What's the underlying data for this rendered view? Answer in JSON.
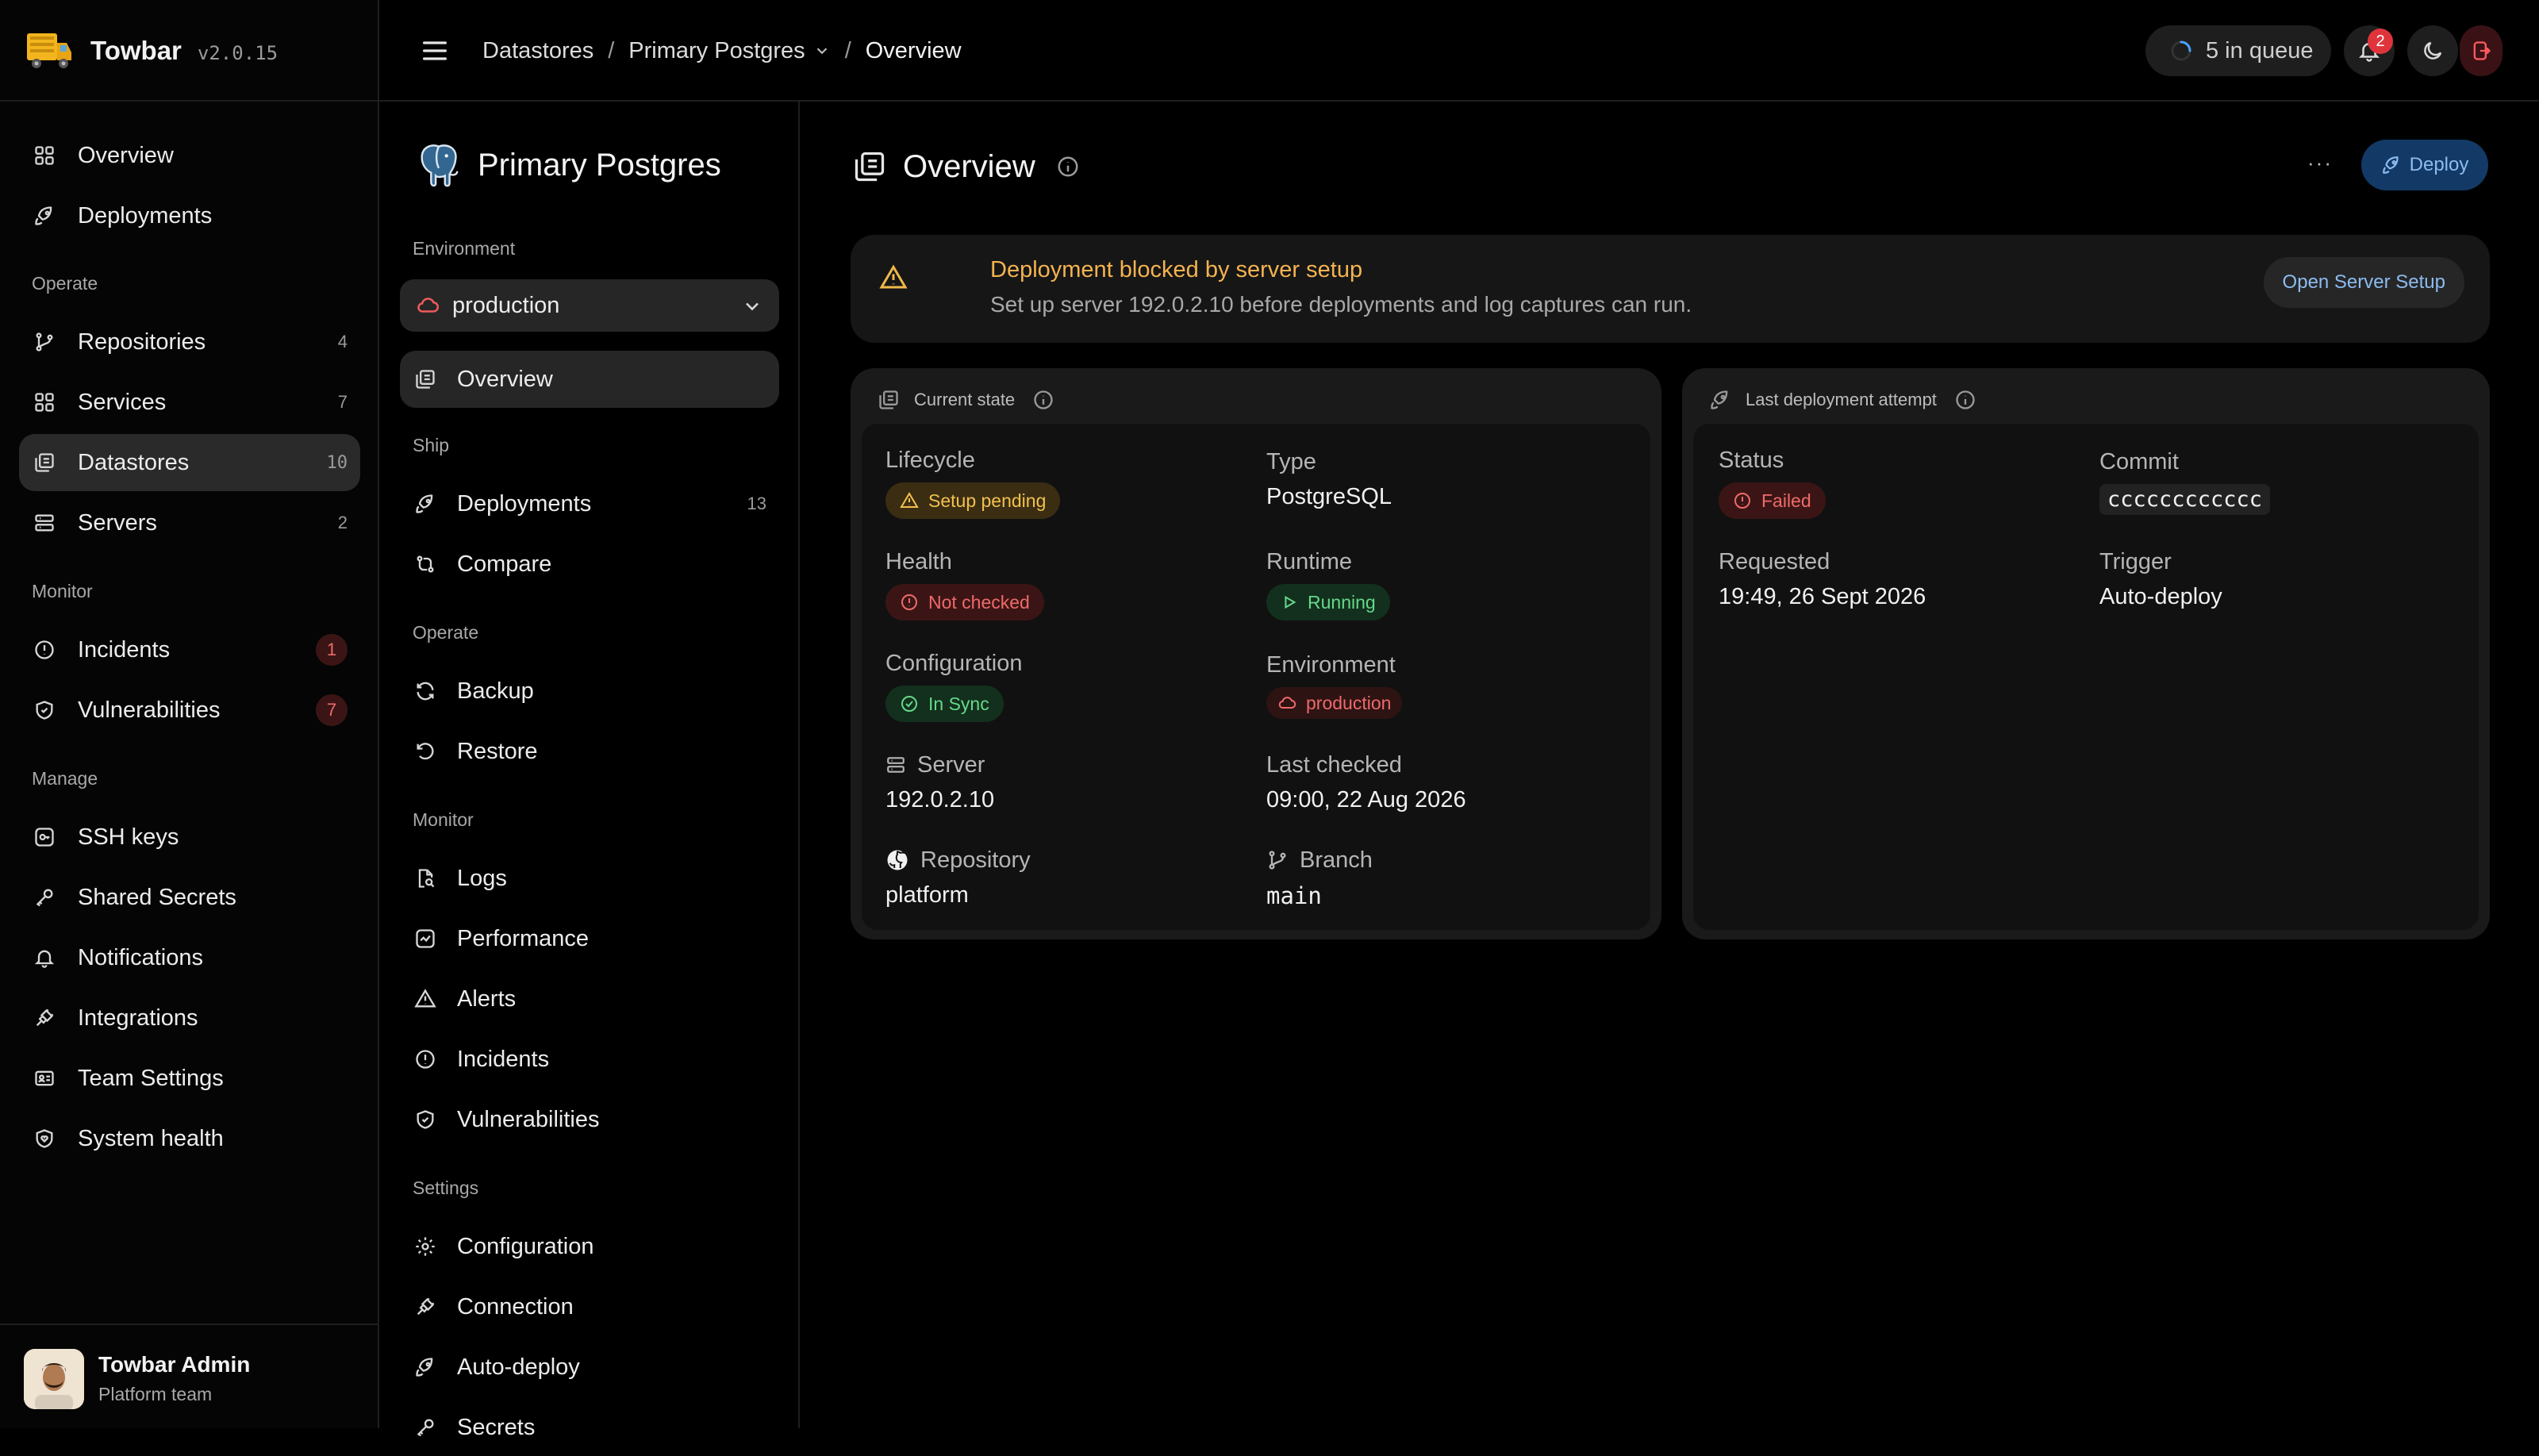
{
  "brand": {
    "name": "Towbar",
    "version": "v2.0.15"
  },
  "sidebar": {
    "top": [
      {
        "label": "Overview"
      },
      {
        "label": "Deployments"
      }
    ],
    "sections": {
      "operate": "Operate",
      "monitor": "Monitor",
      "manage": "Manage"
    },
    "operate": [
      {
        "label": "Repositories",
        "count": "4"
      },
      {
        "label": "Services",
        "count": "7"
      },
      {
        "label": "Datastores",
        "count": "10"
      },
      {
        "label": "Servers",
        "count": "2"
      }
    ],
    "monitor": [
      {
        "label": "Incidents",
        "count": "1"
      },
      {
        "label": "Vulnerabilities",
        "count": "7"
      }
    ],
    "manage": [
      {
        "label": "SSH keys"
      },
      {
        "label": "Shared Secrets"
      },
      {
        "label": "Notifications"
      },
      {
        "label": "Integrations"
      },
      {
        "label": "Team Settings"
      },
      {
        "label": "System health"
      }
    ],
    "user": {
      "name": "Towbar Admin",
      "team": "Platform team"
    }
  },
  "topbar": {
    "breadcrumbs": [
      "Datastores",
      "Primary Postgres",
      "Overview"
    ],
    "queue": "5 in queue",
    "notification_count": "2"
  },
  "subnav": {
    "title": "Primary Postgres",
    "environment_label": "Environment",
    "environment": "production",
    "overview": "Overview",
    "sections": {
      "ship": "Ship",
      "operate": "Operate",
      "monitor": "Monitor",
      "settings": "Settings"
    },
    "ship": [
      {
        "label": "Deployments",
        "count": "13"
      },
      {
        "label": "Compare"
      }
    ],
    "operate": [
      {
        "label": "Backup"
      },
      {
        "label": "Restore"
      }
    ],
    "monitor": [
      {
        "label": "Logs"
      },
      {
        "label": "Performance"
      },
      {
        "label": "Alerts"
      },
      {
        "label": "Incidents"
      },
      {
        "label": "Vulnerabilities"
      }
    ],
    "settings": [
      {
        "label": "Configuration"
      },
      {
        "label": "Connection"
      },
      {
        "label": "Auto-deploy"
      },
      {
        "label": "Secrets"
      }
    ]
  },
  "main": {
    "title": "Overview",
    "more": "···",
    "deploy": "Deploy",
    "alert": {
      "title": "Deployment blocked by server setup",
      "desc": "Set up server 192.0.2.10 before deployments and log captures can run.",
      "action": "Open Server Setup"
    },
    "current_state": {
      "title": "Current state",
      "lifecycle_label": "Lifecycle",
      "lifecycle": "Setup pending",
      "type_label": "Type",
      "type": "PostgreSQL",
      "health_label": "Health",
      "health": "Not checked",
      "runtime_label": "Runtime",
      "runtime": "Running",
      "config_label": "Configuration",
      "config": "In Sync",
      "env_label": "Environment",
      "env": "production",
      "server_label": "Server",
      "server": "192.0.2.10",
      "checked_label": "Last checked",
      "checked": "09:00, 22 Aug 2026",
      "repo_label": "Repository",
      "repo": "platform",
      "branch_label": "Branch",
      "branch": "main"
    },
    "last_deploy": {
      "title": "Last deployment attempt",
      "status_label": "Status",
      "status": "Failed",
      "commit_label": "Commit",
      "commit": "cccccccccccc",
      "requested_label": "Requested",
      "requested": "19:49, 26 Sept 2026",
      "trigger_label": "Trigger",
      "trigger": "Auto-deploy"
    }
  },
  "colors": {
    "accent": "#133a66",
    "warning": "#f4b350",
    "danger": "#ef6a6a",
    "success": "#66d88a"
  }
}
